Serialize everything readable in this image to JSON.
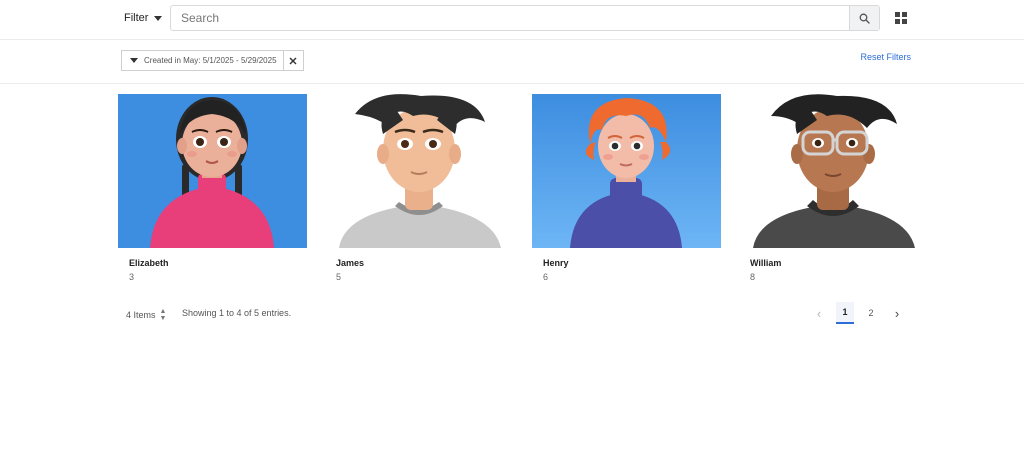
{
  "header": {
    "filter_label": "Filter",
    "search_placeholder": "Search"
  },
  "filters": {
    "chip_label": "Created in May: 5/1/2025 - 5/29/2025",
    "reset_label": "Reset Filters"
  },
  "cards": [
    {
      "name": "Elizabeth",
      "count": "3",
      "background": "#3d8de0"
    },
    {
      "name": "James",
      "count": "5",
      "background": "#ffffff"
    },
    {
      "name": "Henry",
      "count": "6",
      "background": "#4a99e8"
    },
    {
      "name": "William",
      "count": "8",
      "background": "#ffffff"
    }
  ],
  "footer": {
    "items_label": "4 Items",
    "showing_text": "Showing 1 to 4 of 5 entries.",
    "pages": [
      "1",
      "2"
    ],
    "current_page": "1"
  },
  "colors": {
    "accent": "#2b6fd6",
    "border": "#d9d9d9"
  },
  "icons": {
    "search": "search-icon",
    "grid": "grid-view-icon",
    "close": "close-icon",
    "prev": "chevron-left-icon",
    "next": "chevron-right-icon"
  }
}
